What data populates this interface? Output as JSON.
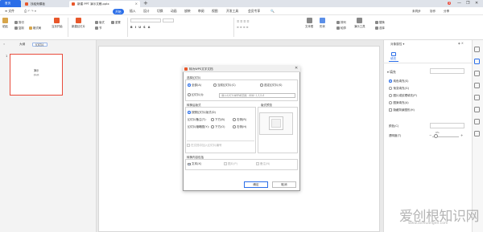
{
  "tabs": {
    "home": "首页",
    "daoke": "找稻壳模板",
    "doc": "新建 PPT 演示文稿.pptx",
    "add": "+"
  },
  "window": {
    "badge": "3",
    "minimize": "—",
    "restore": "❐",
    "close": "✕"
  },
  "menubar": {
    "file": "≡ 文件",
    "items": [
      "开始",
      "插入",
      "设计",
      "切换",
      "动画",
      "放映",
      "审阅",
      "视图",
      "开发工具",
      "会员专享"
    ],
    "search": "🔍",
    "right": [
      "未同步",
      "协作",
      "分享"
    ]
  },
  "toolbar": {
    "paste": "粘贴",
    "cut": "剪切",
    "copy": "复制",
    "format": "格式刷",
    "from_current": "当页开始",
    "new_slide": "新建幻灯片",
    "layout": "版式",
    "section": "节",
    "reset": "重置",
    "bold_row": "B I U S A",
    "text_box": "文本框",
    "shapes": "形状",
    "arrange": "排列",
    "outline": "轮廓",
    "presenter": "演示工具",
    "replace": "替换",
    "select": "选择"
  },
  "leftpane": {
    "outline_tab": "大纲",
    "slides_tab": "幻灯片",
    "slide_number": "1",
    "thumb_title": "演示",
    "thumb_sub": "副标题"
  },
  "rightpane": {
    "title": "对象属性 ▾",
    "icons": "◈ ✕",
    "fill_tab": "填充",
    "section": "▾ 填充",
    "options": [
      {
        "label": "纯色填充(S)",
        "kind": "radio",
        "on": true
      },
      {
        "label": "渐变填充(G)",
        "kind": "radio",
        "on": false
      },
      {
        "label": "图片或纹理填充(P)",
        "kind": "radio",
        "on": false
      },
      {
        "label": "图案填充(A)",
        "kind": "radio",
        "on": false
      },
      {
        "label": "隐藏背景图形(H)",
        "kind": "check",
        "on": false
      }
    ],
    "color_label": "颜色(C)",
    "transparency_label": "透明度(T)",
    "transparency_value": "0%",
    "transparency_level": 0,
    "minus": "−",
    "plus": "+"
  },
  "dialog": {
    "title": "转为WPS文字文档",
    "close": "✕",
    "select_slides": "选择幻灯片",
    "all": "全部(A)",
    "current": "当前幻灯片(C)",
    "selected": "选定幻灯片(S)",
    "range_label": "幻灯片(I):",
    "range_placeholder": "输入幻灯片编号或范围，例如: 1,3,5-8",
    "layout_group": "转换后版式",
    "preview_group": "版式预览",
    "default_layout": "按照幻灯片版式(D)",
    "notes_label": "幻灯片备注(T):",
    "notes_below": "下方(B)",
    "notes_right": "右侧(R)",
    "thumb_label": "幻灯片缩略图(Y):",
    "thumb_below": "下方(O)",
    "thumb_right": "右侧(H)",
    "add_numbers": "在文档中加入幻灯片编号",
    "content_group": "转换内容包括",
    "text": "文本(X)",
    "images": "图片(P)",
    "notes": "备注(N)",
    "ok": "确定",
    "cancel": "取消"
  },
  "watermark": {
    "text": "爱创根知识网",
    "url": "www.aichuangen.com"
  },
  "colors": {
    "accent": "#2b6ee8",
    "orange": "#e8572a",
    "thumb_border": "#e94b3c"
  }
}
